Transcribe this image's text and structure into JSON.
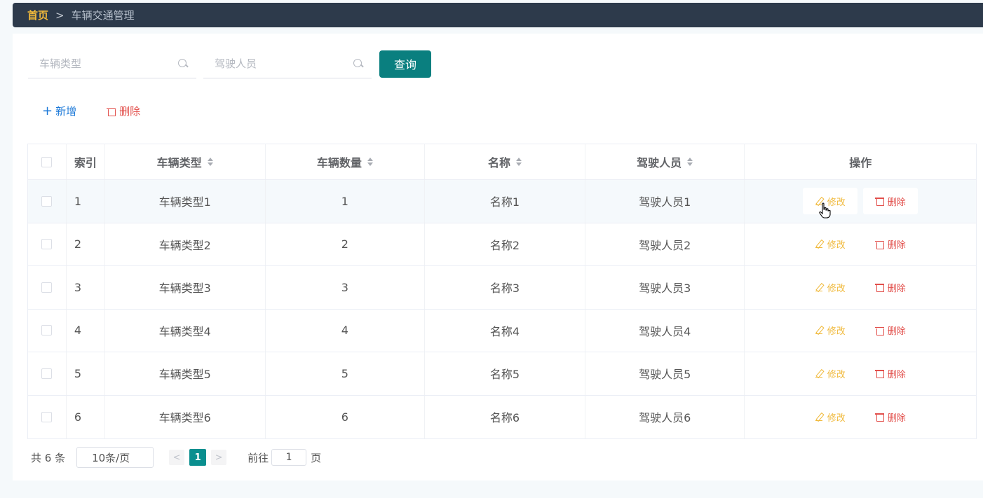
{
  "breadcrumb": {
    "home": "首页",
    "separator": ">",
    "current": "车辆交通管理"
  },
  "search": {
    "vehicle_type_placeholder": "车辆类型",
    "driver_placeholder": "驾驶人员",
    "query_label": "查询"
  },
  "actions": {
    "add_label": "新增",
    "delete_label": "删除"
  },
  "table": {
    "headers": [
      "索引",
      "车辆类型",
      "车辆数量",
      "名称",
      "驾驶人员",
      "操作"
    ],
    "edit_label": "修改",
    "delete_label": "删除",
    "rows": [
      {
        "index": "1",
        "type": "车辆类型1",
        "count": "1",
        "name": "名称1",
        "driver": "驾驶人员1"
      },
      {
        "index": "2",
        "type": "车辆类型2",
        "count": "2",
        "name": "名称2",
        "driver": "驾驶人员2"
      },
      {
        "index": "3",
        "type": "车辆类型3",
        "count": "3",
        "name": "名称3",
        "driver": "驾驶人员3"
      },
      {
        "index": "4",
        "type": "车辆类型4",
        "count": "4",
        "name": "名称4",
        "driver": "驾驶人员4"
      },
      {
        "index": "5",
        "type": "车辆类型5",
        "count": "5",
        "name": "名称5",
        "driver": "驾驶人员5"
      },
      {
        "index": "6",
        "type": "车辆类型6",
        "count": "6",
        "name": "名称6",
        "driver": "驾驶人员6"
      }
    ]
  },
  "pagination": {
    "total_text": "共 6 条",
    "page_size": "10条/页",
    "prev": "<",
    "current_page": "1",
    "next": ">",
    "goto_label": "前往",
    "goto_value": "1",
    "page_unit": "页"
  },
  "colors": {
    "primary": "#0a7f7f",
    "topbar": "#2d3a4b",
    "edit": "#f0b93b",
    "delete": "#e2504c",
    "add": "#1b78d8"
  }
}
